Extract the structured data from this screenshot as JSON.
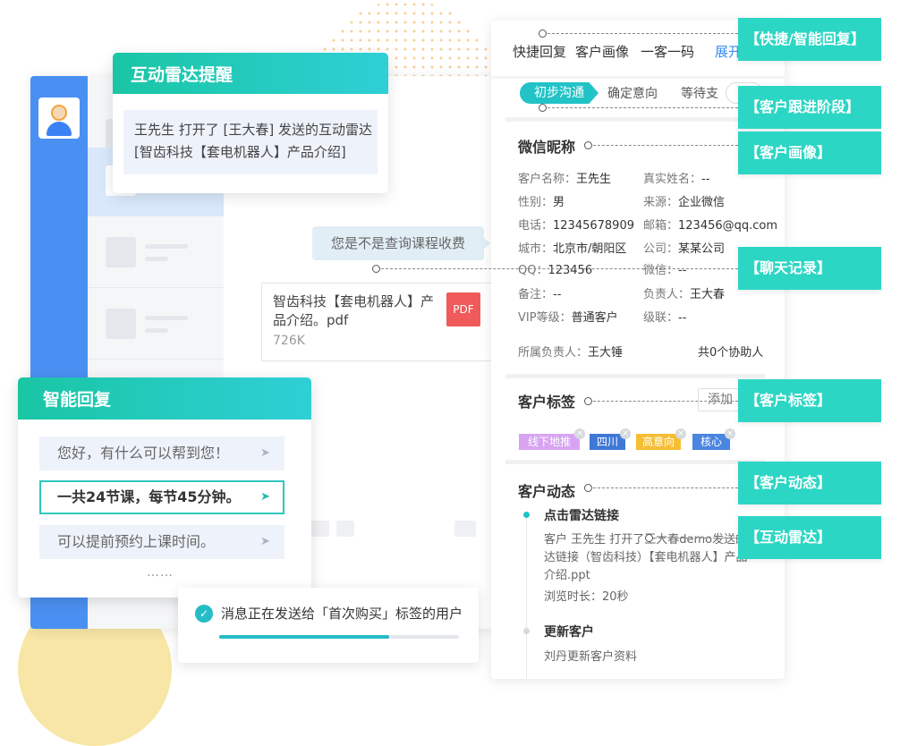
{
  "radar_popup": {
    "title": "互动雷达提醒",
    "message": "王先生 打开了 [王大春] 发送的互动雷达 [智齿科技【套电机器人】产品介绍]"
  },
  "chat": {
    "bubble_text": "您是不是查询课程收费",
    "file": {
      "name": "智齿科技【套电机器人】产品介绍。pdf",
      "size": "726K",
      "type_label": "PDF"
    }
  },
  "smart_reply": {
    "title": "智能回复",
    "replies": [
      {
        "text": "您好，有什么可以帮到您！"
      },
      {
        "text": "一共24节课，每节45分钟。"
      },
      {
        "text": "可以提前预约上课时间。"
      }
    ],
    "more": "……"
  },
  "toast": {
    "text": "消息正在发送给「首次购买」标签的用户",
    "progress": 0.71
  },
  "panel": {
    "tabs": [
      "快捷回复",
      "客户画像",
      "一客一码",
      "展开"
    ],
    "stages": [
      "初步沟通",
      "确定意向",
      "等待支"
    ],
    "profile": {
      "title": "微信昵称",
      "fields": [
        {
          "label": "客户名称：",
          "value": "王先生"
        },
        {
          "label": "真实姓名：",
          "value": "--"
        },
        {
          "label": "性别：",
          "value": "男"
        },
        {
          "label": "来源：",
          "value": "企业微信"
        },
        {
          "label": "电话：",
          "value": "12345678909"
        },
        {
          "label": "邮箱：",
          "value": "123456@qq.com"
        },
        {
          "label": "城市：",
          "value": "北京市/朝阳区"
        },
        {
          "label": "公司：",
          "value": "某某公司"
        },
        {
          "label": "QQ：",
          "value": "123456"
        },
        {
          "label": "微信：",
          "value": "--"
        },
        {
          "label": "备注：",
          "value": "--"
        },
        {
          "label": "负责人：",
          "value": "王大春"
        },
        {
          "label": "VIP等级：",
          "value": "普通客户"
        },
        {
          "label": "级联：",
          "value": "--"
        }
      ],
      "owner_label": "所属负责人：",
      "owner_value": "王大锤",
      "assist": "共0个协助人"
    },
    "tags": {
      "title": "客户标签",
      "add_label": "添加",
      "items": [
        {
          "text": "线下地推",
          "color": "#d8a4f2"
        },
        {
          "text": "四川",
          "color": "#3f78d6"
        },
        {
          "text": "高意向",
          "color": "#f5be33"
        },
        {
          "text": "核心",
          "color": "#4a85e0"
        }
      ]
    },
    "activity": {
      "title": "客户动态",
      "items": [
        {
          "title": "点击雷达链接",
          "lines": [
            "客户 王先生 打开了王大春demo发送的",
            "达链接（智齿科技）【套电机器人】产品",
            "介绍.ppt",
            "浏览时长：20秒"
          ]
        },
        {
          "title": "更新客户",
          "lines": [
            "刘丹更新客户资料"
          ]
        }
      ]
    }
  },
  "callouts": [
    "【快捷/智能回复】",
    "【客户跟进阶段】",
    "【客户画像】",
    "【聊天记录】",
    "【客户标签】",
    "【客户动态】",
    "【互动雷达】"
  ],
  "colors": {
    "accent": "#22c3c6",
    "rail": "#4a90f2",
    "callout": "#2cd6c4"
  }
}
